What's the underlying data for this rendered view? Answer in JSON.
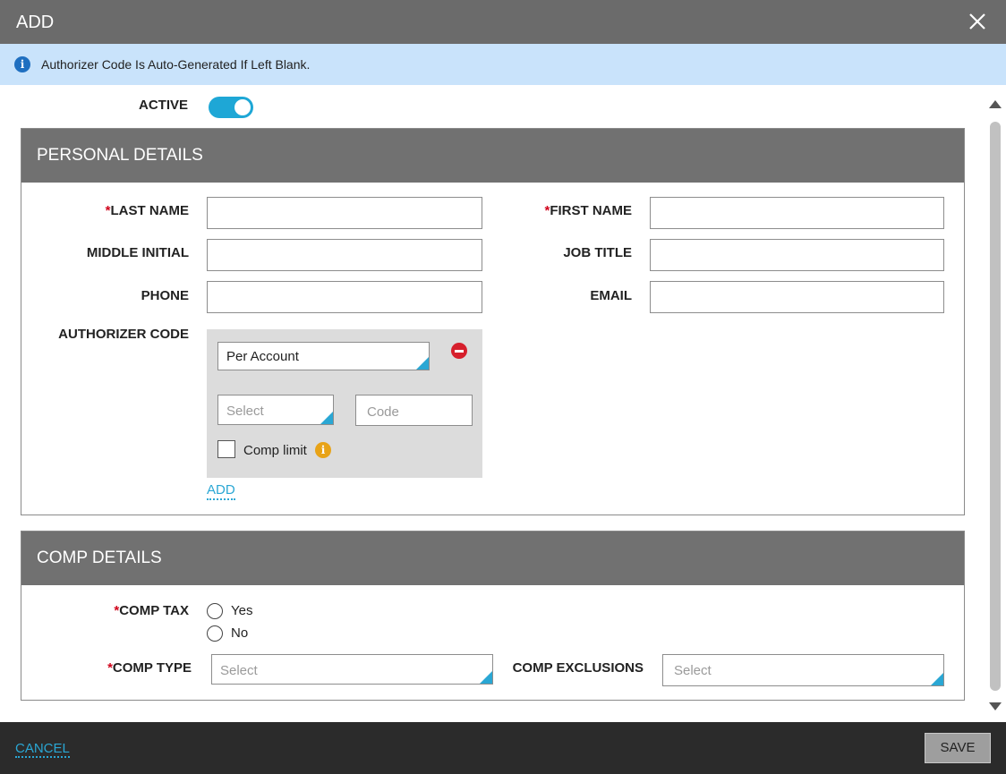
{
  "dialog": {
    "title": "ADD",
    "close_icon": "close-icon"
  },
  "info": {
    "icon": "info-icon",
    "message": "Authorizer Code Is Auto-Generated If Left Blank."
  },
  "active": {
    "label": "ACTIVE",
    "on": true
  },
  "personal": {
    "heading": "PERSONAL DETAILS",
    "required_mark": "*",
    "last_name_label": "LAST NAME",
    "first_name_label": "FIRST NAME",
    "middle_initial_label": "MIDDLE INITIAL",
    "job_title_label": "JOB TITLE",
    "phone_label": "PHONE",
    "email_label": "EMAIL",
    "authorizer_code_label": "AUTHORIZER CODE",
    "values": {
      "last_name": "",
      "first_name": "",
      "middle_initial": "",
      "job_title": "",
      "phone": "",
      "email": ""
    },
    "authorizer": {
      "scope_value": "Per Account",
      "select_placeholder": "Select",
      "code_placeholder": "Code",
      "comp_limit_label": "Comp limit",
      "comp_limit_checked": false,
      "add_link": "ADD"
    }
  },
  "comp": {
    "heading": "COMP DETAILS",
    "required_mark": "*",
    "comp_tax_label": "COMP TAX",
    "comp_tax_options": [
      "Yes",
      "No"
    ],
    "comp_type_label": "COMP TYPE",
    "comp_type_placeholder": "Select",
    "comp_exclusions_label": "COMP EXCLUSIONS",
    "comp_exclusions_placeholder": "Select"
  },
  "footer": {
    "cancel": "CANCEL",
    "save": "SAVE"
  },
  "colors": {
    "accent": "#2aa7d4",
    "header_gray": "#717171",
    "titlebar": "#6b6b6b",
    "footer": "#2b2b2b",
    "info_bg": "#c9e3fb",
    "required": "#d0021b",
    "remove": "#d61f2c",
    "tip": "#e8a317"
  }
}
